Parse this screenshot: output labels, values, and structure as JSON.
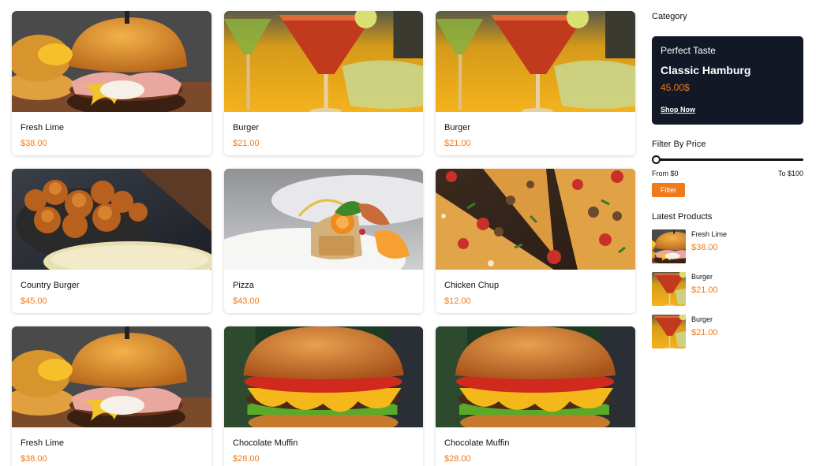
{
  "products": [
    {
      "name": "Fresh Lime",
      "price": "$38.00",
      "image": "burger-egg-image"
    },
    {
      "name": "Burger",
      "price": "$21.00",
      "image": "cocktail-image"
    },
    {
      "name": "Burger",
      "price": "$21.00",
      "image": "cocktail-image"
    },
    {
      "name": "Country Burger",
      "price": "$45.00",
      "image": "fried-chicken-image"
    },
    {
      "name": "Pizza",
      "price": "$43.00",
      "image": "plated-dish-image"
    },
    {
      "name": "Chicken Chup",
      "price": "$12.00",
      "image": "pizza-image"
    },
    {
      "name": "Fresh Lime",
      "price": "$38.00",
      "image": "burger-egg-image"
    },
    {
      "name": "Chocolate Muffin",
      "price": "$28.00",
      "image": "cheeseburger-image"
    },
    {
      "name": "Chocolate Muffin",
      "price": "$28.00",
      "image": "cheeseburger-image"
    }
  ],
  "sidebar": {
    "category_title": "Category",
    "promo": {
      "subtitle": "Perfect Taste",
      "title": "Classic Hamburg",
      "price": "45.00$",
      "link": "Shop Now"
    },
    "filter": {
      "title": "Filter By Price",
      "from_label": "From $0",
      "to_label": "To $100",
      "button": "Filter",
      "slider_value": 0
    },
    "latest": {
      "title": "Latest Products",
      "items": [
        {
          "name": "Fresh Lime",
          "price": "$38.00",
          "image": "burger-egg-image"
        },
        {
          "name": "Burger",
          "price": "$21.00",
          "image": "cocktail-image"
        },
        {
          "name": "Burger",
          "price": "$21.00",
          "image": "cocktail-image"
        }
      ]
    }
  },
  "colors": {
    "accent": "#f07a1a",
    "promo_bg": "#121826"
  }
}
